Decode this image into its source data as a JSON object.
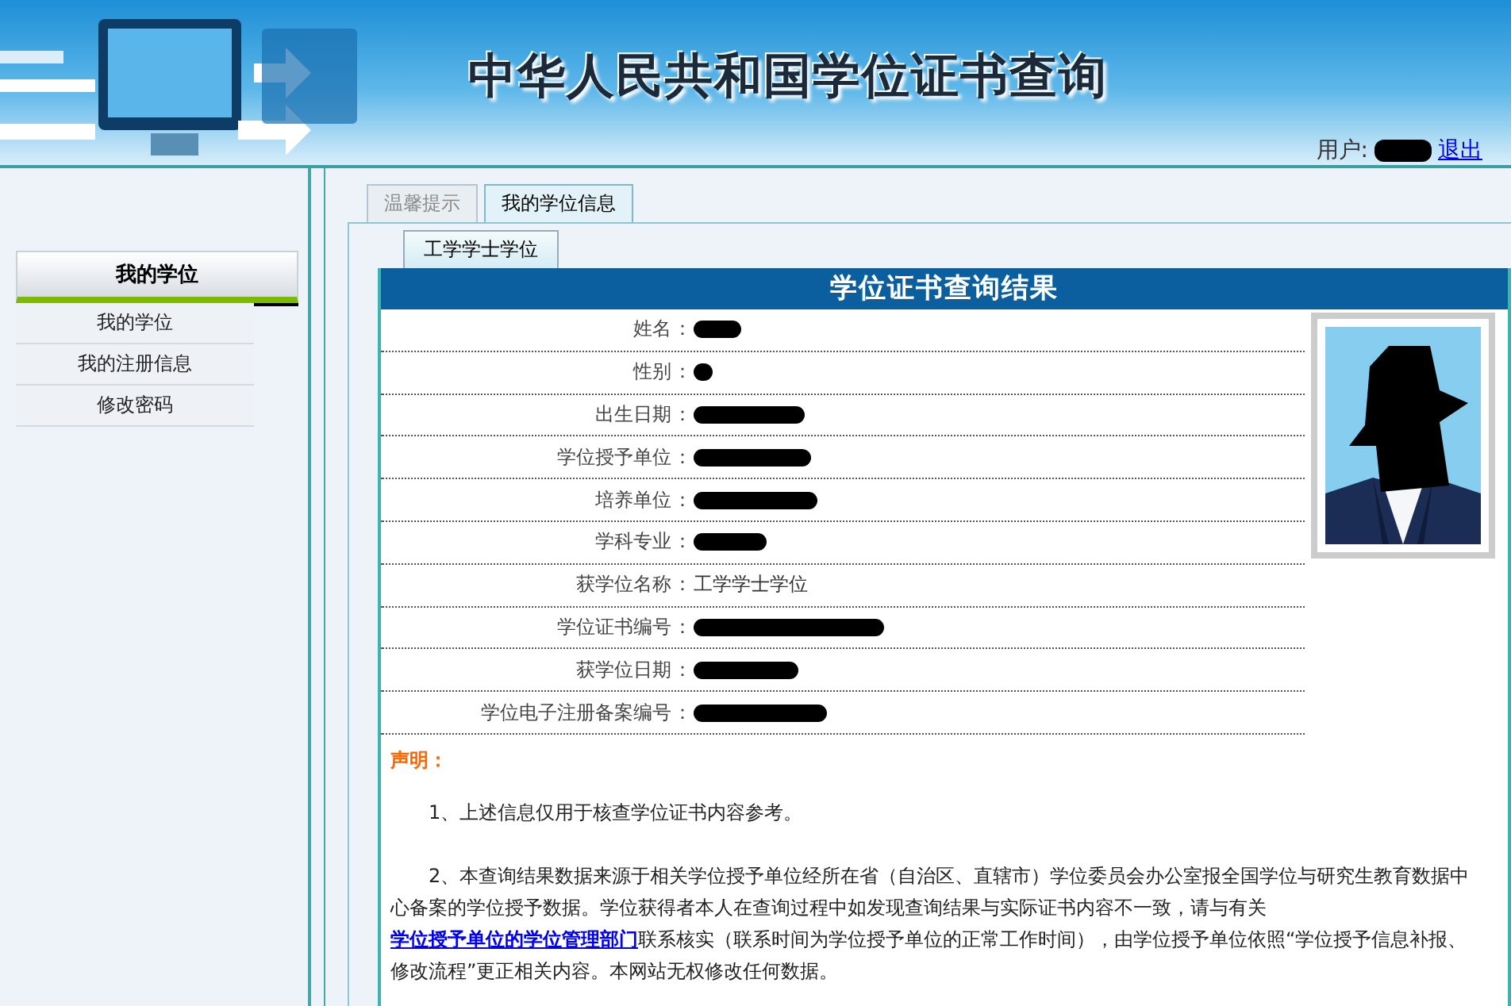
{
  "header": {
    "title": "中华人民共和国学位证书查询",
    "user_label": "用户:",
    "user_redacted": true,
    "logout": "退出"
  },
  "sidebar": {
    "heading": "我的学位",
    "items": [
      {
        "label": "我的学位",
        "selected": false
      },
      {
        "label": "我的注册信息",
        "selected": false
      },
      {
        "label": "修改密码",
        "selected": false
      }
    ]
  },
  "tabs": [
    {
      "label": "温馨提示",
      "selected": false
    },
    {
      "label": "我的学位信息",
      "selected": true
    }
  ],
  "subtabs": [
    {
      "label": "工学学士学位",
      "selected": true
    }
  ],
  "result": {
    "title": "学位证书查询结果",
    "rows": [
      {
        "label": "姓名",
        "sep": "：",
        "kind": "redacted"
      },
      {
        "label": "性别",
        "sep": "：",
        "kind": "redacted"
      },
      {
        "label": "出生日期",
        "sep": "：",
        "kind": "redacted"
      },
      {
        "label": "学位授予单位",
        "sep": "：",
        "kind": "redacted"
      },
      {
        "label": "培养单位",
        "sep": "：",
        "kind": "redacted"
      },
      {
        "label": "学科专业",
        "sep": "：",
        "kind": "redacted"
      },
      {
        "label": "获学位名称",
        "sep": "：",
        "kind": "text",
        "value": "工学学士学位"
      },
      {
        "label": "学位证书编号",
        "sep": "：",
        "kind": "redacted"
      },
      {
        "label": "获学位日期",
        "sep": "：",
        "kind": "redacted"
      },
      {
        "label": "学位电子注册备案编号",
        "sep": "：",
        "kind": "redacted"
      }
    ]
  },
  "notice": {
    "heading": "声明：",
    "items": [
      {
        "text": "1、上述信息仅用于核查学位证书内容参考。"
      },
      {
        "text": "2、本查询结果数据来源于相关学位授予单位经所在省（自治区、直辖市）学位委员会办公室报全国学位与研究生教育数据中心备案的学位授予数据。学位获得者本人在查询过程中如发现查询结果与实际证书内容不一致，请与有关",
        "link": "学位授予单位的学位管理部门",
        "after": "联系核实（联系时间为学位授予单位的正常工作时间），由学位授予单位依照“学位授予信息补报、修改流程”更正相关内容。本网站无权修改任何数据。"
      }
    ]
  }
}
